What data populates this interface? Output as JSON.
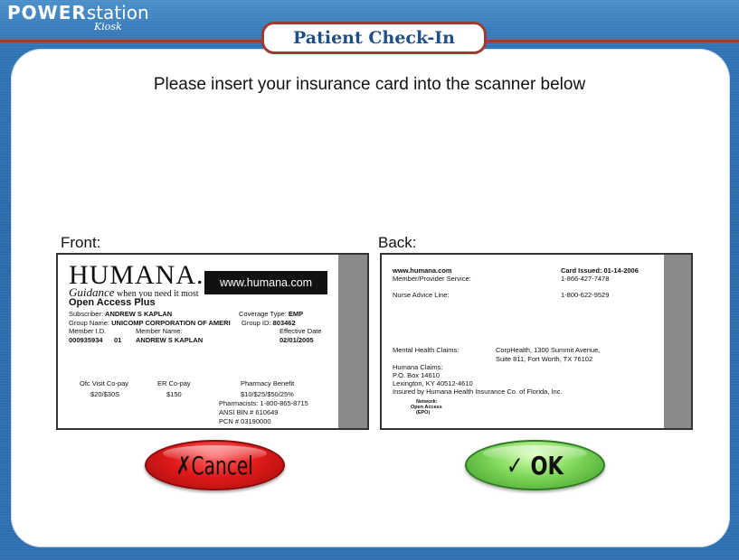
{
  "app": {
    "logo_power": "POWER",
    "logo_station": "station",
    "logo_kiosk": "Kiosk",
    "title": "Patient Check-In"
  },
  "main": {
    "instruction": "Please insert your insurance card into the scanner below",
    "front_label": "Front:",
    "back_label": "Back:"
  },
  "front_card": {
    "brand": "HUMANA.",
    "tagline_italic": "Guidance",
    "tagline_rest": "when you need it most",
    "url": "www.humana.com",
    "plan": "Open Access Plus",
    "subscriber_label": "Subscriber:",
    "subscriber": "ANDREW S KAPLAN",
    "coverage_label": "Coverage Type:",
    "coverage": "EMP",
    "group_name_label": "Group Name:",
    "group_name": "UNICOMP CORPORATION OF AMERI",
    "group_id_label": "Group ID:",
    "group_id": "803462",
    "member_id_label": "Member I.D.",
    "member_name_label": "Member Name:",
    "effective_label": "Effective Date",
    "member_id": "000935934",
    "member_suffix": "01",
    "member_name": "ANDREW S KAPLAN",
    "effective_date": "02/01/2005",
    "ofc_label": "Ofc Visit Co-pay",
    "ofc_value": "$20/$30S",
    "er_label": "ER Co-pay",
    "er_value": "$150",
    "pharm_label": "Pharmacy Benefit",
    "pharm_value": "$10/$25/$50/25%",
    "pharmacists": "Pharmacists: 1-800-865-8715",
    "ansi": "ANSI BIN # 610649",
    "pcn": "PCN # 03190000"
  },
  "back_card": {
    "website": "www.humana.com",
    "card_issued": "Card Issued: 01-14-2006",
    "member_service_label": "Member/Provider Service:",
    "member_service_phone": "1-866-427-7478",
    "nurse_label": "Nurse Advice Line:",
    "nurse_phone": "1-800-622-9529",
    "mental_label": "Mental Health Claims:",
    "mental_line1": "CorpHealth, 1300 Summit Avenue,",
    "mental_line2": "Suite 811, Fort Worth, TX 76102",
    "claims_label": "Humana Claims:",
    "claims_line1": "P.O. Box 14610",
    "claims_line2": "Lexington, KY 40512-4610",
    "insured_by": "Insured by Humana Health Insurance Co. of Florida, Inc.",
    "network_label": "Network:",
    "network_name": "Open Access",
    "network_type": "(EPO)"
  },
  "buttons": {
    "cancel_icon": "✗",
    "cancel_label": "Cancel",
    "ok_icon": "✓",
    "ok_label": "OK"
  },
  "colors": {
    "background": "#2f73b5",
    "title_border": "#a03a30",
    "title_text": "#1e4f86",
    "cancel": "#e11a1a",
    "ok": "#7fd85a"
  }
}
